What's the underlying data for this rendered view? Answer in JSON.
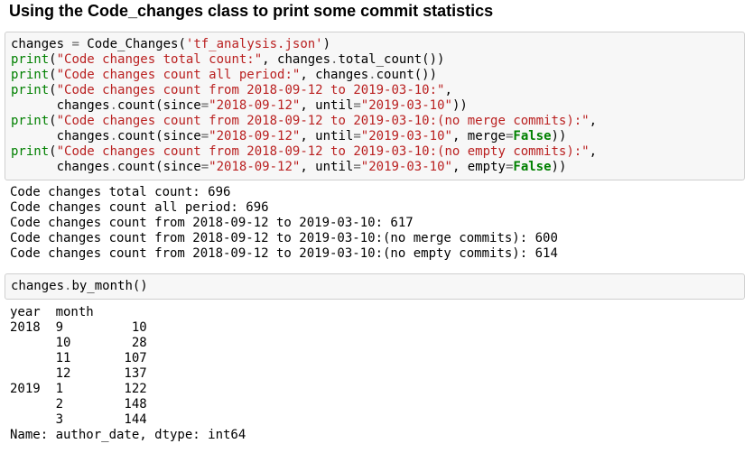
{
  "heading": "Using the Code_changes class to print some commit statistics",
  "cell1": {
    "lines": [
      [
        [
          "plain",
          "changes "
        ],
        [
          "op",
          "="
        ],
        [
          "plain",
          " Code_Changes("
        ],
        [
          "str",
          "'tf_analysis.json'"
        ],
        [
          "plain",
          ")"
        ]
      ],
      [
        [
          "kw",
          "print"
        ],
        [
          "plain",
          "("
        ],
        [
          "str",
          "\"Code changes total count:\""
        ],
        [
          "plain",
          ", changes"
        ],
        [
          "op",
          "."
        ],
        [
          "plain",
          "total_count())"
        ]
      ],
      [
        [
          "kw",
          "print"
        ],
        [
          "plain",
          "("
        ],
        [
          "str",
          "\"Code changes count all period:\""
        ],
        [
          "plain",
          ", changes"
        ],
        [
          "op",
          "."
        ],
        [
          "plain",
          "count())"
        ]
      ],
      [
        [
          "kw",
          "print"
        ],
        [
          "plain",
          "("
        ],
        [
          "str",
          "\"Code changes count from 2018-09-12 to 2019-03-10:\""
        ],
        [
          "plain",
          ","
        ]
      ],
      [
        [
          "plain",
          "      changes"
        ],
        [
          "op",
          "."
        ],
        [
          "plain",
          "count(since"
        ],
        [
          "op",
          "="
        ],
        [
          "str",
          "\"2018-09-12\""
        ],
        [
          "plain",
          ", until"
        ],
        [
          "op",
          "="
        ],
        [
          "str",
          "\"2019-03-10\""
        ],
        [
          "plain",
          "))"
        ]
      ],
      [
        [
          "kw",
          "print"
        ],
        [
          "plain",
          "("
        ],
        [
          "str",
          "\"Code changes count from 2018-09-12 to 2019-03-10:(no merge commits):\""
        ],
        [
          "plain",
          ","
        ]
      ],
      [
        [
          "plain",
          "      changes"
        ],
        [
          "op",
          "."
        ],
        [
          "plain",
          "count(since"
        ],
        [
          "op",
          "="
        ],
        [
          "str",
          "\"2018-09-12\""
        ],
        [
          "plain",
          ", until"
        ],
        [
          "op",
          "="
        ],
        [
          "str",
          "\"2019-03-10\""
        ],
        [
          "plain",
          ", merge"
        ],
        [
          "op",
          "="
        ],
        [
          "bool",
          "False"
        ],
        [
          "plain",
          "))"
        ]
      ],
      [
        [
          "kw",
          "print"
        ],
        [
          "plain",
          "("
        ],
        [
          "str",
          "\"Code changes count from 2018-09-12 to 2019-03-10:(no empty commits):\""
        ],
        [
          "plain",
          ","
        ]
      ],
      [
        [
          "plain",
          "      changes"
        ],
        [
          "op",
          "."
        ],
        [
          "plain",
          "count(since"
        ],
        [
          "op",
          "="
        ],
        [
          "str",
          "\"2018-09-12\""
        ],
        [
          "plain",
          ", until"
        ],
        [
          "op",
          "="
        ],
        [
          "str",
          "\"2019-03-10\""
        ],
        [
          "plain",
          ", empty"
        ],
        [
          "op",
          "="
        ],
        [
          "bool",
          "False"
        ],
        [
          "plain",
          "))"
        ]
      ]
    ]
  },
  "output1": [
    "Code changes total count: 696",
    "Code changes count all period: 696",
    "Code changes count from 2018-09-12 to 2019-03-10: 617",
    "Code changes count from 2018-09-12 to 2019-03-10:(no merge commits): 600",
    "Code changes count from 2018-09-12 to 2019-03-10:(no empty commits): 614"
  ],
  "cell2": {
    "lines": [
      [
        [
          "plain",
          "changes"
        ],
        [
          "op",
          "."
        ],
        [
          "plain",
          "by_month()"
        ]
      ]
    ]
  },
  "output2": [
    "year  month",
    "2018  9         10",
    "      10        28",
    "      11       107",
    "      12       137",
    "2019  1        122",
    "      2        148",
    "      3        144",
    "Name: author_date, dtype: int64"
  ],
  "colors": {
    "keyword": "#008000",
    "string": "#ba2121",
    "operator": "#666666",
    "cell_bg": "#f7f7f7",
    "cell_border": "#cfcfcf"
  }
}
